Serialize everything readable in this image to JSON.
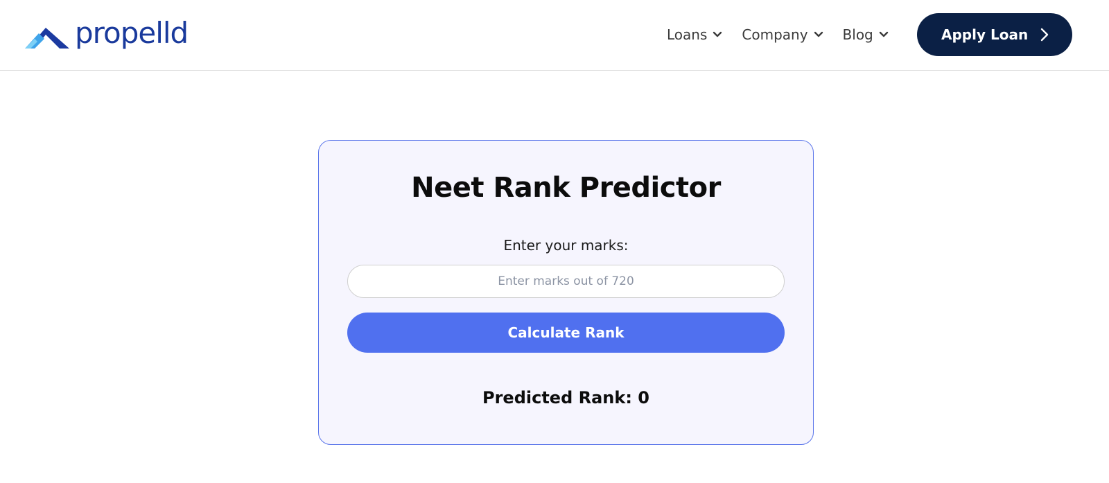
{
  "header": {
    "logo_text": "propelld",
    "nav": [
      {
        "label": "Loans"
      },
      {
        "label": "Company"
      },
      {
        "label": "Blog"
      }
    ],
    "apply_label": "Apply Loan"
  },
  "colors": {
    "brand_blue": "#1a3a9c",
    "dark_navy": "#0b2045",
    "accent": "#5070ef",
    "card_bg": "#f6f5fe"
  },
  "card": {
    "title": "Neet Rank Predictor",
    "marks_label": "Enter your marks:",
    "marks_placeholder": "Enter marks out of 720",
    "marks_value": "",
    "button_label": "Calculate Rank",
    "result_text": "Predicted Rank: 0"
  }
}
